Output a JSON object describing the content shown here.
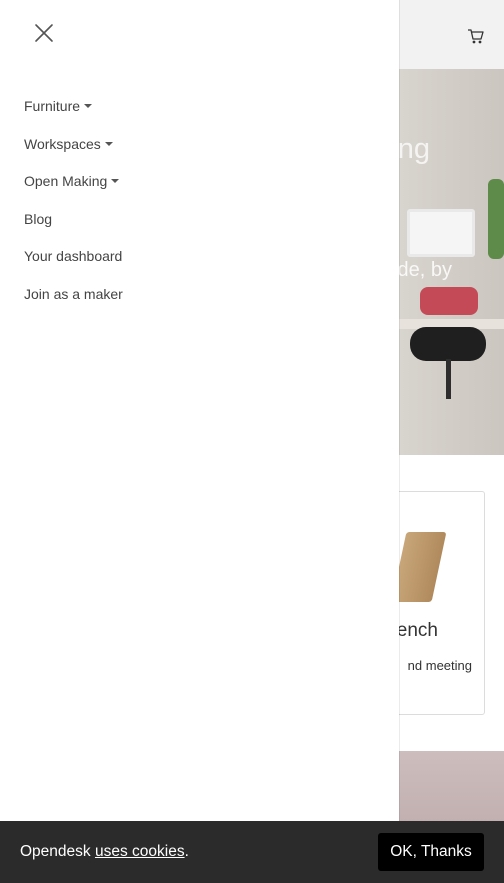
{
  "hero": {
    "title_fragment": "ng",
    "subtitle_fragment": "de, by"
  },
  "card": {
    "title_fragment": "ench",
    "text_fragment": "nd meeting"
  },
  "drawer": {
    "items": [
      {
        "label": "Furniture",
        "dropdown": true
      },
      {
        "label": "Workspaces",
        "dropdown": true
      },
      {
        "label": "Open Making",
        "dropdown": true
      },
      {
        "label": "Blog",
        "dropdown": false
      },
      {
        "label": "Your dashboard",
        "dropdown": false
      },
      {
        "label": "Join as a maker",
        "dropdown": false
      }
    ]
  },
  "icons": {
    "close": "close-icon",
    "cart": "shopping-cart-icon"
  },
  "cookie": {
    "prefix": "Opendesk ",
    "link": "uses cookies",
    "suffix": ".",
    "button": "OK, Thanks"
  },
  "colors": {
    "cookie_bar": "#2b2b2b",
    "ok_button": "#000000",
    "topbar": "#f2f2f2"
  }
}
